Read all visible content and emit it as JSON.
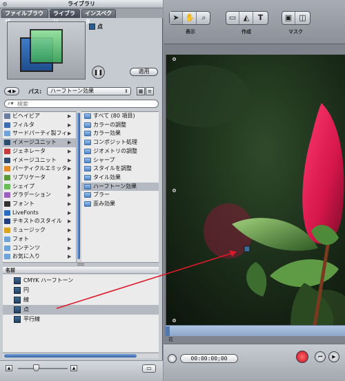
{
  "library": {
    "window_title": "ライブラリ",
    "tabs": [
      {
        "label": "ファイルブラウザ",
        "active": false
      },
      {
        "label": "ライブラリ",
        "active": true
      },
      {
        "label": "インスペクタ",
        "active": false
      }
    ],
    "selected_item_name": "点",
    "pause_icon": "pause-icon",
    "apply_label": "適用",
    "path_label": "パス:",
    "path_value": "ハーフトーン効果",
    "search_placeholder": "検索",
    "categories": [
      {
        "label": "ビヘイビア",
        "icon": "gear",
        "color": "#6a7f9e",
        "selected": false
      },
      {
        "label": "フィルタ",
        "icon": "filter",
        "color": "#3d6fb0",
        "selected": false
      },
      {
        "label": "サードパーティ製フィ",
        "icon": "folder",
        "color": "#6fa3d9",
        "selected": false
      },
      {
        "label": "イメージユニット",
        "icon": "image-unit",
        "color": "#2d4d6e",
        "selected": true
      },
      {
        "label": "ジェネレータ",
        "icon": "generator",
        "color": "#c43d3d",
        "selected": false
      },
      {
        "label": "イメージユニット",
        "icon": "image-unit",
        "color": "#2d4d6e",
        "selected": false
      },
      {
        "label": "パーティクルエミッタ",
        "icon": "particle",
        "color": "#e08a2a",
        "selected": false
      },
      {
        "label": "リプリケータ",
        "icon": "replicator",
        "color": "#5a9a3a",
        "selected": false
      },
      {
        "label": "シェイプ",
        "icon": "shape",
        "color": "#6bbf5a",
        "selected": false
      },
      {
        "label": "グラデーション",
        "icon": "gradient",
        "color": "#9b5fbf",
        "selected": false
      },
      {
        "label": "フォント",
        "icon": "font",
        "color": "#333333",
        "selected": false
      },
      {
        "label": "LiveFonts",
        "icon": "livefonts",
        "color": "#2a6fbf",
        "selected": false
      },
      {
        "label": "テキストのスタイル",
        "icon": "text-style",
        "color": "#1f3f7f",
        "selected": false
      },
      {
        "label": "ミュージック",
        "icon": "music",
        "color": "#d9a424",
        "selected": false
      },
      {
        "label": "フォト",
        "icon": "photo",
        "color": "#6fa3d9",
        "selected": false
      },
      {
        "label": "コンテンツ",
        "icon": "folder",
        "color": "#6fa3d9",
        "selected": false
      },
      {
        "label": "お気に入り",
        "icon": "folder",
        "color": "#6fa3d9",
        "selected": false
      }
    ],
    "subcategories": [
      {
        "label": "すべて (80 項目)",
        "selected": false
      },
      {
        "label": "カラーの調整",
        "selected": false
      },
      {
        "label": "カラー効果",
        "selected": false
      },
      {
        "label": "コンポジット処理",
        "selected": false
      },
      {
        "label": "ジオメトリの調整",
        "selected": false
      },
      {
        "label": "シャープ",
        "selected": false
      },
      {
        "label": "スタイルを調整",
        "selected": false
      },
      {
        "label": "タイル効果",
        "selected": false
      },
      {
        "label": "ハーフトーン効果",
        "selected": true
      },
      {
        "label": "ブラー",
        "selected": false
      },
      {
        "label": "歪み効果",
        "selected": false
      }
    ],
    "items_header": "名前",
    "items": [
      {
        "label": "CMYK ハーフトーン",
        "selected": false
      },
      {
        "label": "円",
        "selected": false
      },
      {
        "label": "線",
        "selected": false
      },
      {
        "label": "点",
        "selected": true
      },
      {
        "label": "平行線",
        "selected": false
      }
    ]
  },
  "canvas": {
    "toolbar_labels": {
      "view": "表示",
      "create": "作成",
      "mask": "マスク"
    },
    "timeline_label": "花",
    "timecode": "00:00:00;00"
  },
  "colors": {
    "selection": "#b5b9c1",
    "accent_blue": "#2e5fa6",
    "drag_arrow": "#e0192a",
    "flower_red": "#d4164a"
  }
}
